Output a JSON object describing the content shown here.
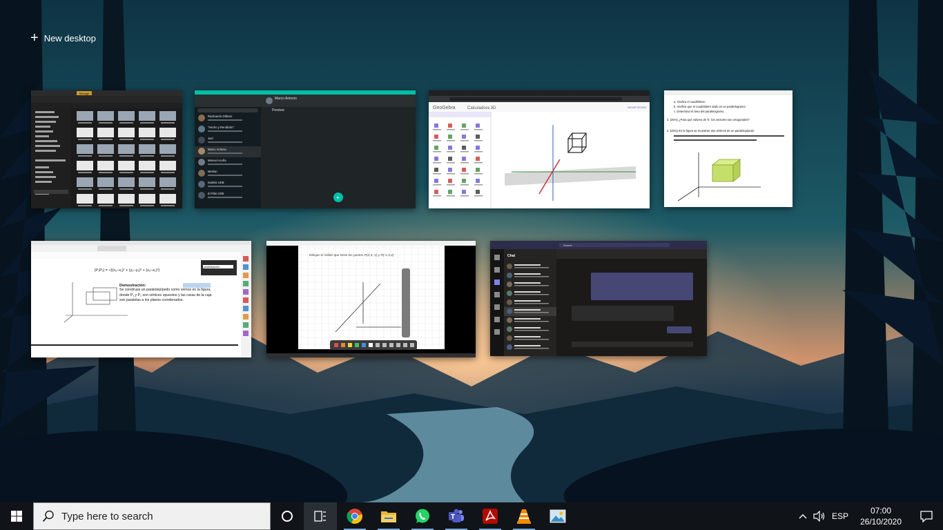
{
  "new_desktop_label": "New desktop",
  "thumbnails": {
    "file_explorer": {
      "title": "Manage"
    },
    "whatsapp": {
      "contact": "Marco Antonio",
      "pane": "Preview",
      "chats": [
        "Radicando Otiliano",
        "\"Hecho y Rendición\"",
        "Juel",
        "Marco Antonio",
        "Manuel Acuña",
        "Menlan",
        "Isabela UDB",
        "El Pibe UDB"
      ]
    },
    "geogebra": {
      "brand": "GeoGebra",
      "app": "Calculadora 3D",
      "signin": "INICIAR SESIÓN"
    },
    "exercise": {
      "lines": [
        "a.  Grafica el cuadrilátero",
        "b.  Verifica que el cuadrilátero dado es un paralelogramo",
        "c.  Determina el área del paralelogramo.",
        "3.  (25%) ¿Para qué valores de 'k', los vectores son ortogonales?",
        "4.  (25%) En la figura se muestran dos vértices de un paralelepípedo"
      ]
    },
    "pdf": {
      "formula": "|P₁P₂| = √((x₂−x₁)² + (y₂−y₁)² + (z₂−z₁)²)",
      "heading": "Demostración:",
      "text": "Se construye un paralelepípedo como vemos en la figura, donde P₁ y P₂ son vértices opuestos y las caras de la caja son paralelas a los planos coordenados.",
      "search_word": "paralelepípedo"
    },
    "whiteboard": {
      "note": "Dibujar el sólido que tiene los puntos P(2,4,-1) y R(-1,3,2)"
    },
    "teams": {
      "header": "Chat",
      "search": "Search"
    }
  },
  "taskbar": {
    "search_placeholder": "Type here to search",
    "apps": [
      "chrome-icon",
      "file-explorer-icon",
      "whatsapp-icon",
      "teams-icon",
      "acrobat-icon",
      "vlc-icon",
      "photos-icon"
    ],
    "language": "ESP",
    "time": "07:00",
    "date": "26/10/2020"
  }
}
